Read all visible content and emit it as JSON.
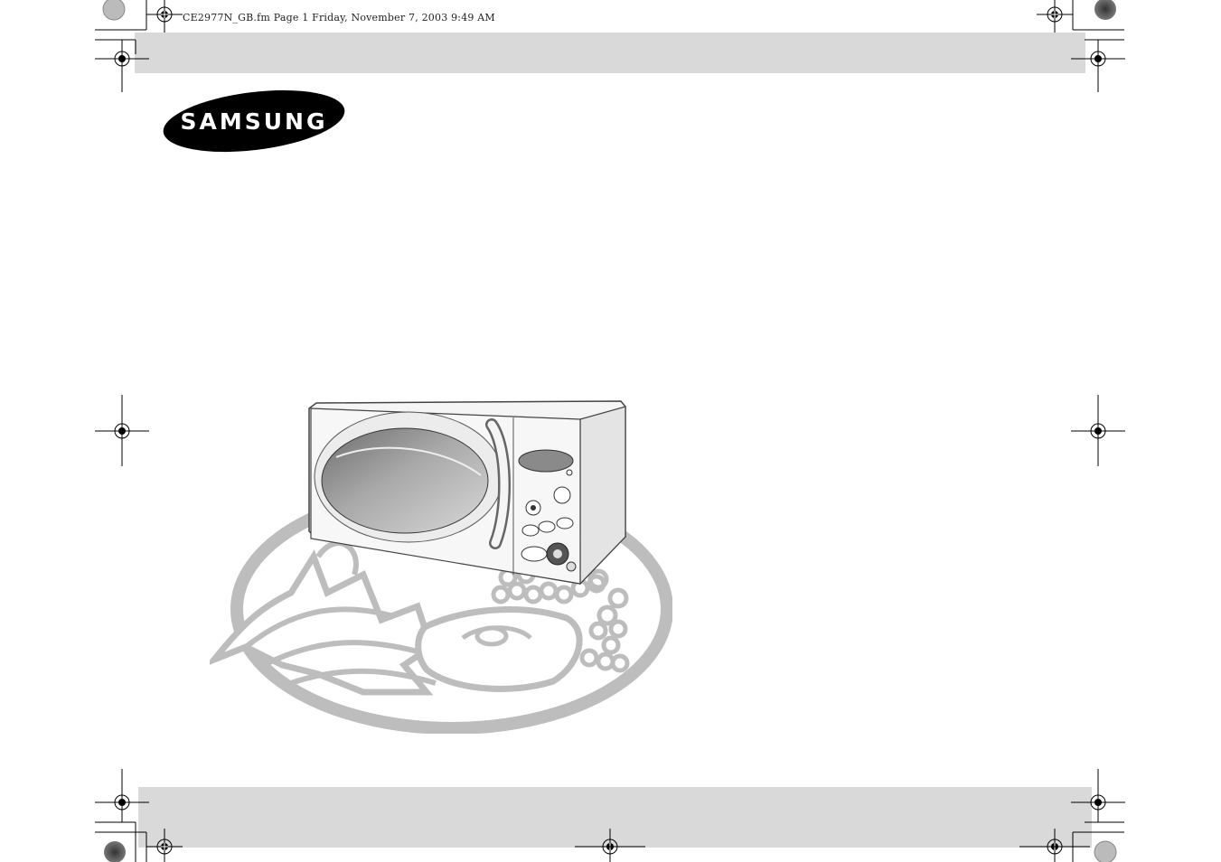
{
  "header": {
    "file_info": "CE2977N_GB.fm  Page 1  Friday, November 7, 2003  9:49 AM"
  },
  "logo": {
    "brand_text": "SAMSUNG"
  },
  "illustration": {
    "subject": "microwave-oven-with-food-platter"
  },
  "colors": {
    "band_gray": "#d9d9d9",
    "logo_black": "#000000",
    "platter_gray": "#bdbdbd"
  }
}
